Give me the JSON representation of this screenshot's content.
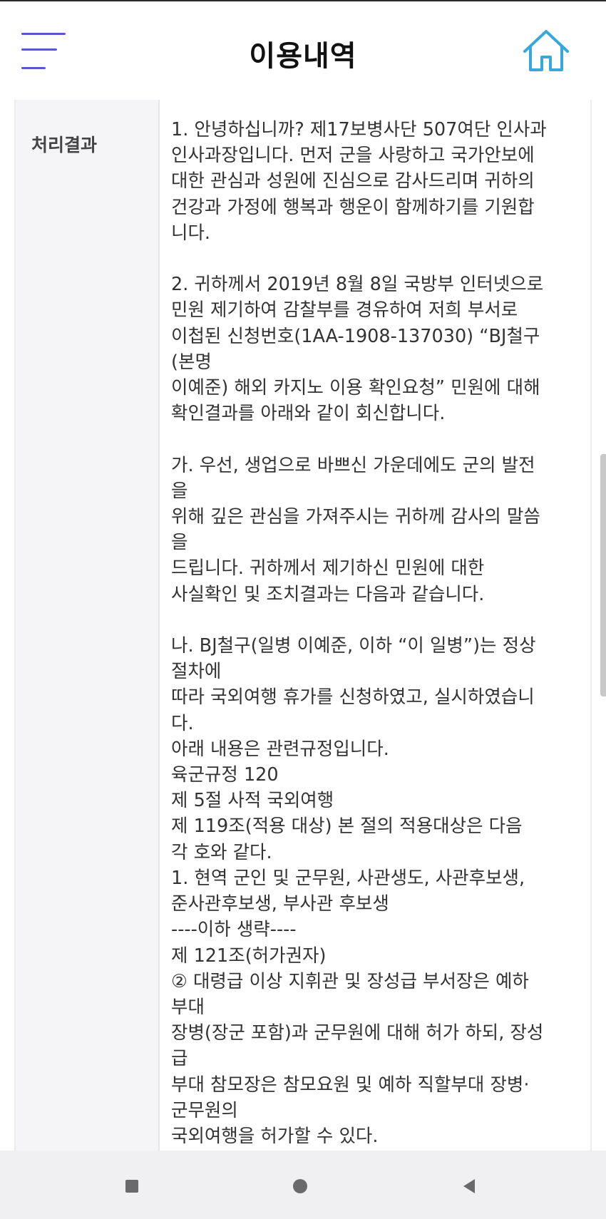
{
  "header": {
    "title": "이용내역",
    "menu_icon": "hamburger-menu-icon",
    "home_icon": "home-icon",
    "accent_color": "#5b56c9",
    "home_icon_color": "#37a8d8"
  },
  "detail": {
    "label": "처리결과",
    "lines": [
      "1. 안녕하십니까? 제17보병사단 507여단 인사과",
      "인사과장입니다. 먼저 군을 사랑하고 국가안보에",
      "대한 관심과 성원에 진심으로 감사드리며 귀하의",
      "건강과 가정에 행복과 행운이 함께하기를 기원합",
      "니다.",
      "",
      "2. 귀하께서 2019년 8월 8일 국방부 인터넷으로",
      "민원 제기하여 감찰부를 경유하여 저희 부서로",
      "이첩된 신청번호(1AA-1908-137030) “BJ철구",
      "(본명",
      "이예준) 해외 카지노 이용 확인요청” 민원에 대해",
      "확인결과를 아래와 같이 회신합니다.",
      "",
      "가. 우선, 생업으로 바쁘신 가운데에도 군의 발전",
      "을",
      "위해 깊은 관심을 가져주시는 귀하께 감사의 말씀",
      "을",
      "드립니다. 귀하께서 제기하신 민원에 대한",
      "사실확인 및 조치결과는 다음과 같습니다.",
      "",
      "나. BJ철구(일병 이예준, 이하 “이 일병”)는 정상",
      "절차에",
      "따라 국외여행 휴가를 신청하였고, 실시하였습니",
      "다.",
      "아래 내용은 관련규정입니다.",
      "육군규정 120",
      "제 5절 사적 국외여행",
      "제 119조(적용 대상) 본 절의 적용대상은 다음",
      "각 호와 같다.",
      "1. 현역 군인 및 군무원, 사관생도, 사관후보생,",
      "준사관후보생, 부사관 후보생",
      "----이하 생략----",
      "제 121조(허가권자)",
      "② 대령급 이상 지휘관 및 장성급 부서장은 예하",
      "부대",
      "장병(장군 포함)과 군무원에 대해 허가 하되, 장성",
      "급",
      "부대 참모장은 참모요원 및 예하 직할부대 장병·",
      "군무원의",
      "국외여행을 허가할 수 있다."
    ]
  },
  "navbar": {
    "recent_apps_icon": "recent-apps-icon",
    "home_nav_icon": "circle-home-icon",
    "back_icon": "back-triangle-icon"
  }
}
